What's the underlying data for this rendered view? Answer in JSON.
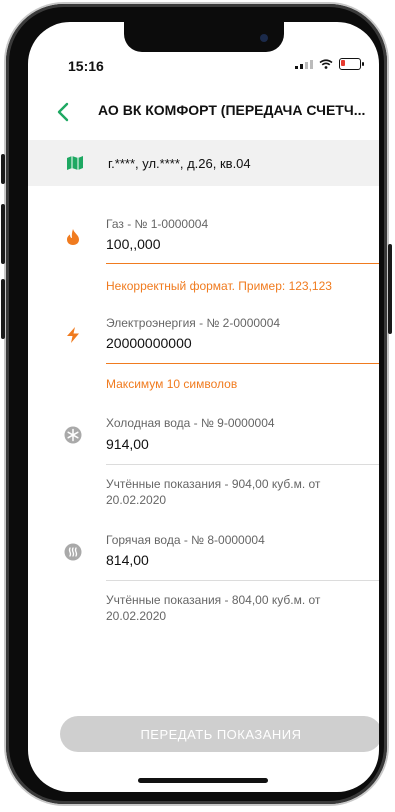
{
  "status": {
    "time": "15:16"
  },
  "header": {
    "title": "АО ВК КОМФОРТ (ПЕРЕДАЧА СЧЕТЧ..."
  },
  "address": {
    "text": "г.****, ул.****, д.26, кв.04"
  },
  "meters": [
    {
      "label": "Газ - № 1-0000004",
      "value": "100,,000",
      "error": "Некорректный формат. Пример: 123,123"
    },
    {
      "label": "Электроэнергия - № 2-0000004",
      "value": "20000000000",
      "error": "Максимум 10 символов"
    },
    {
      "label": "Холодная вода - № 9-0000004",
      "value": "914,00",
      "note": "Учтённые показания - 904,00 куб.м. от 20.02.2020"
    },
    {
      "label": "Горячая вода - № 8-0000004",
      "value": "814,00",
      "note": "Учтённые показания - 804,00 куб.м. от 20.02.2020"
    }
  ],
  "actions": {
    "submit_label": "ПЕРЕДАТЬ ПОКАЗАНИЯ"
  },
  "colors": {
    "accent": "#1ea862",
    "error": "#f07b1f",
    "disabled": "#cfcfcf"
  },
  "icons": {
    "back": "chevron-left-icon",
    "address": "map-icon",
    "gas": "flame-icon",
    "electricity": "lightning-icon",
    "cold_water": "snowflake-icon",
    "hot_water": "steam-icon"
  }
}
